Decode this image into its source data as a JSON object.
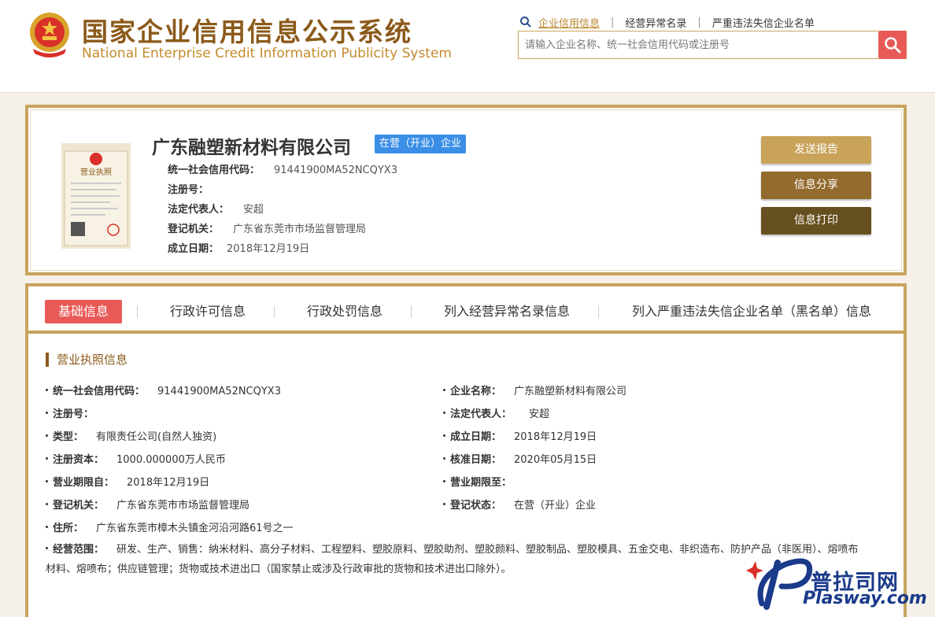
{
  "header": {
    "title_cn": "国家企业信用信息公示系统",
    "title_en": "National Enterprise Credit Information Publicity System",
    "links": [
      "企业信用信息",
      "经营异常名录",
      "严重违法失信企业名单"
    ],
    "search_placeholder": "请输入企业名称、统一社会信用代码或注册号"
  },
  "company": {
    "name": "广东融塑新材料有限公司",
    "status_badge": "在营（开业）企业",
    "fields": [
      {
        "label": "统一社会信用代码：",
        "value": "91441900MA52NCQYX3"
      },
      {
        "label": "注册号：",
        "value": ""
      },
      {
        "label": "法定代表人：",
        "value": "安超"
      },
      {
        "label": "登记机关：",
        "value": "广东省东莞市市场监督管理局"
      },
      {
        "label": "成立日期：",
        "value": "2018年12月19日"
      }
    ],
    "buttons": {
      "send": "发送报告",
      "share": "信息分享",
      "print": "信息打印"
    }
  },
  "tabs": [
    "基础信息",
    "行政许可信息",
    "行政处罚信息",
    "列入经营异常名录信息",
    "列入严重违法失信企业名单（黑名单）信息"
  ],
  "details": {
    "section_title": "营业执照信息",
    "left": [
      {
        "label": "统一社会信用代码：",
        "value": "91441900MA52NCQYX3"
      },
      {
        "label": "注册号：",
        "value": ""
      },
      {
        "label": "类型：",
        "value": "有限责任公司(自然人独资)"
      },
      {
        "label": "注册资本：",
        "value": "1000.000000万人民币"
      },
      {
        "label": "营业期限自：",
        "value": "2018年12月19日"
      },
      {
        "label": "登记机关：",
        "value": "广东省东莞市市场监督管理局"
      },
      {
        "label": "住所：",
        "value": "广东省东莞市樟木头镇金河沿河路61号之一"
      }
    ],
    "right": [
      {
        "label": "企业名称：",
        "value": "广东融塑新材料有限公司"
      },
      {
        "label": "法定代表人：",
        "value": "安超"
      },
      {
        "label": "成立日期：",
        "value": "2018年12月19日"
      },
      {
        "label": "核准日期：",
        "value": "2020年05月15日"
      },
      {
        "label": "营业期限至：",
        "value": ""
      },
      {
        "label": "登记状态：",
        "value": "在营（开业）企业"
      }
    ],
    "scope_label": "经营范围：",
    "scope_value": "研发、生产、销售：纳米材料、高分子材料、工程塑料、塑胶原料、塑胶助剂、塑胶颜料、塑胶制品、塑胶模具、五金交电、非织造布、防护产品（非医用）、熔喷布材料、熔喷布；供应链管理；货物或技术进出口（国家禁止或涉及行政审批的货物和技术进出口除外）。"
  },
  "watermark": {
    "text": "普拉司网",
    "url": "Plasway.com"
  }
}
